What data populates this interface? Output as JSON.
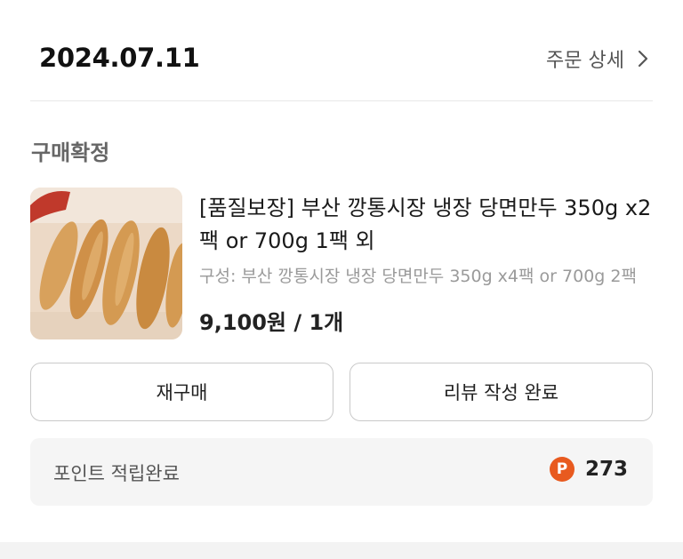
{
  "order": {
    "date": "2024.07.11",
    "detail_label": "주문 상세",
    "status": "구매확정"
  },
  "product": {
    "title": "[품질보장] 부산 깡통시장 냉장 당면만두 350g x2팩 or 700g 1팩 외",
    "option": "구성: 부산 깡통시장 냉장 당면만두 350g x4팩 or 700g 2팩",
    "price": "9,100원 / 1개"
  },
  "actions": {
    "rebuy_label": "재구매",
    "review_label": "리뷰 작성 완료"
  },
  "points": {
    "label": "포인트 적립완료",
    "badge": "P",
    "value": "273"
  },
  "colors": {
    "badge": "#e85a1f",
    "points_bg": "#f5f5f5"
  }
}
